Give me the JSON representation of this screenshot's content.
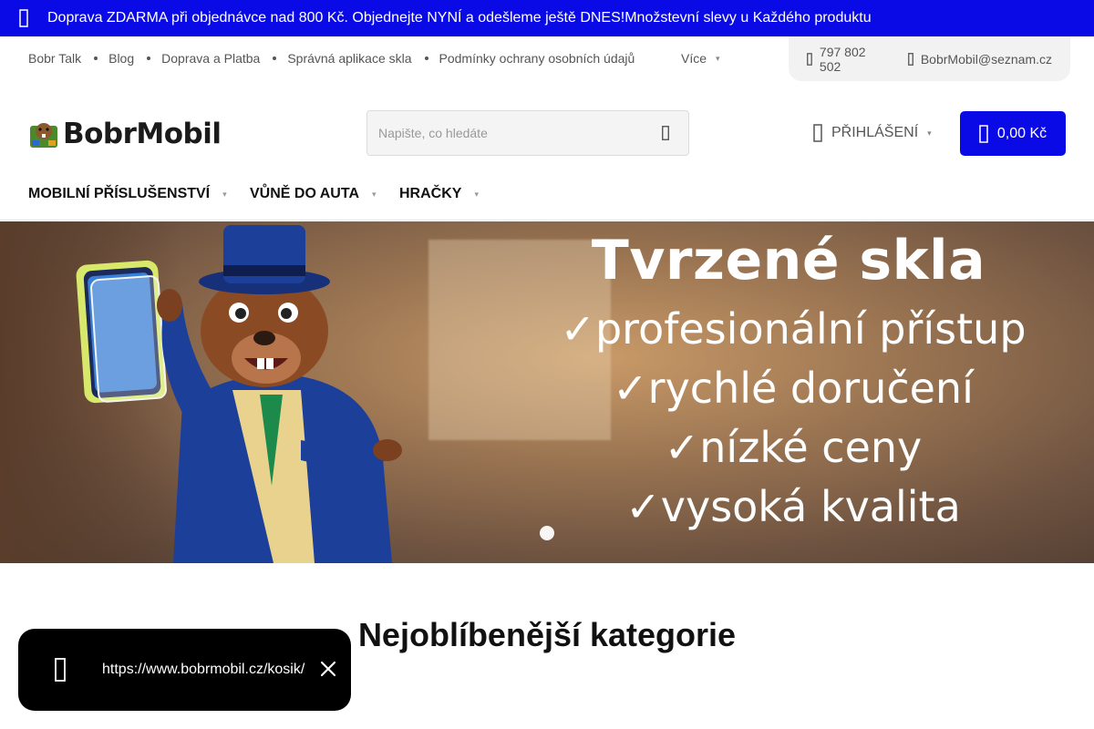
{
  "announcement": {
    "text": "Doprava ZDARMA při objednávce nad 800 Kč. Objednejte NYNÍ a odešleme ještě DNES!Množstevní slevy u Každého produktu"
  },
  "utility_nav": {
    "links": [
      "Bobr Talk",
      "Blog",
      "Doprava a Platba",
      "Správná aplikace skla",
      "Podmínky ochrany osobních údajů"
    ],
    "more_label": "Více",
    "phone": "797 802 502",
    "email": "BobrMobil@seznam.cz"
  },
  "header": {
    "logo_text": "BobrMobil",
    "search_placeholder": "Napište, co hledáte",
    "login_label": "PŘIHLÁŠENÍ",
    "cart_total": "0,00 Kč"
  },
  "categories": [
    "MOBILNÍ PŘÍSLUŠENSTVÍ",
    "VŮNĚ DO AUTA",
    "HRAČKY"
  ],
  "hero": {
    "headline": "Tvrzené skla",
    "bullets": [
      "✓profesionální přístup",
      "✓rychlé doručení",
      "✓nízké ceny",
      "✓vysoká kvalita"
    ]
  },
  "section": {
    "title": "Nejoblíbenější kategorie"
  },
  "toast": {
    "url": "https://www.bobrmobil.cz/kosik/"
  },
  "colors": {
    "brand_blue": "#0a0ae6",
    "toast_bg": "#000000"
  }
}
